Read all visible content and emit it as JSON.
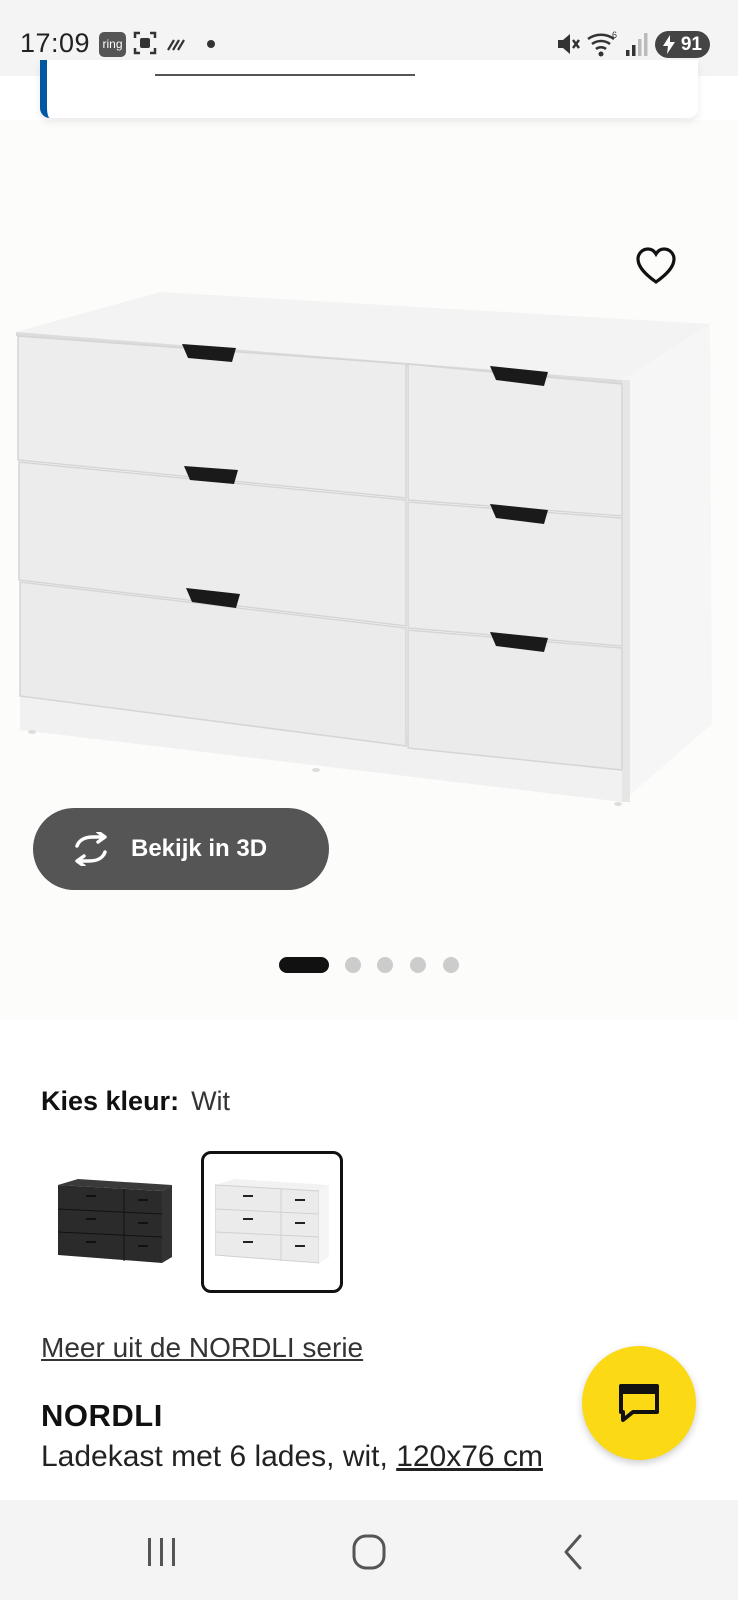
{
  "status_bar": {
    "time": "17:09",
    "ring_label": "ring",
    "battery": "91",
    "icons": [
      "ring-icon",
      "screenshot-icon",
      "link-icon",
      "mute-icon",
      "wifi-icon",
      "signal-icon",
      "battery-icon"
    ]
  },
  "product_image": {
    "view_3d_label": "Bekijk in 3D",
    "carousel_count": 5,
    "carousel_active": 0
  },
  "color": {
    "label": "Kies kleur:",
    "selected_value": "Wit",
    "options": [
      "zwart",
      "wit"
    ]
  },
  "series_link": "Meer uit de NORDLI serie",
  "product": {
    "name": "NORDLI",
    "description": "Ladekast met 6 lades, wit, ",
    "size": "120x76 cm"
  },
  "colors": {
    "accent_blue": "#0058a3",
    "chat_yellow": "#fbd914",
    "button_dark": "#555555"
  }
}
